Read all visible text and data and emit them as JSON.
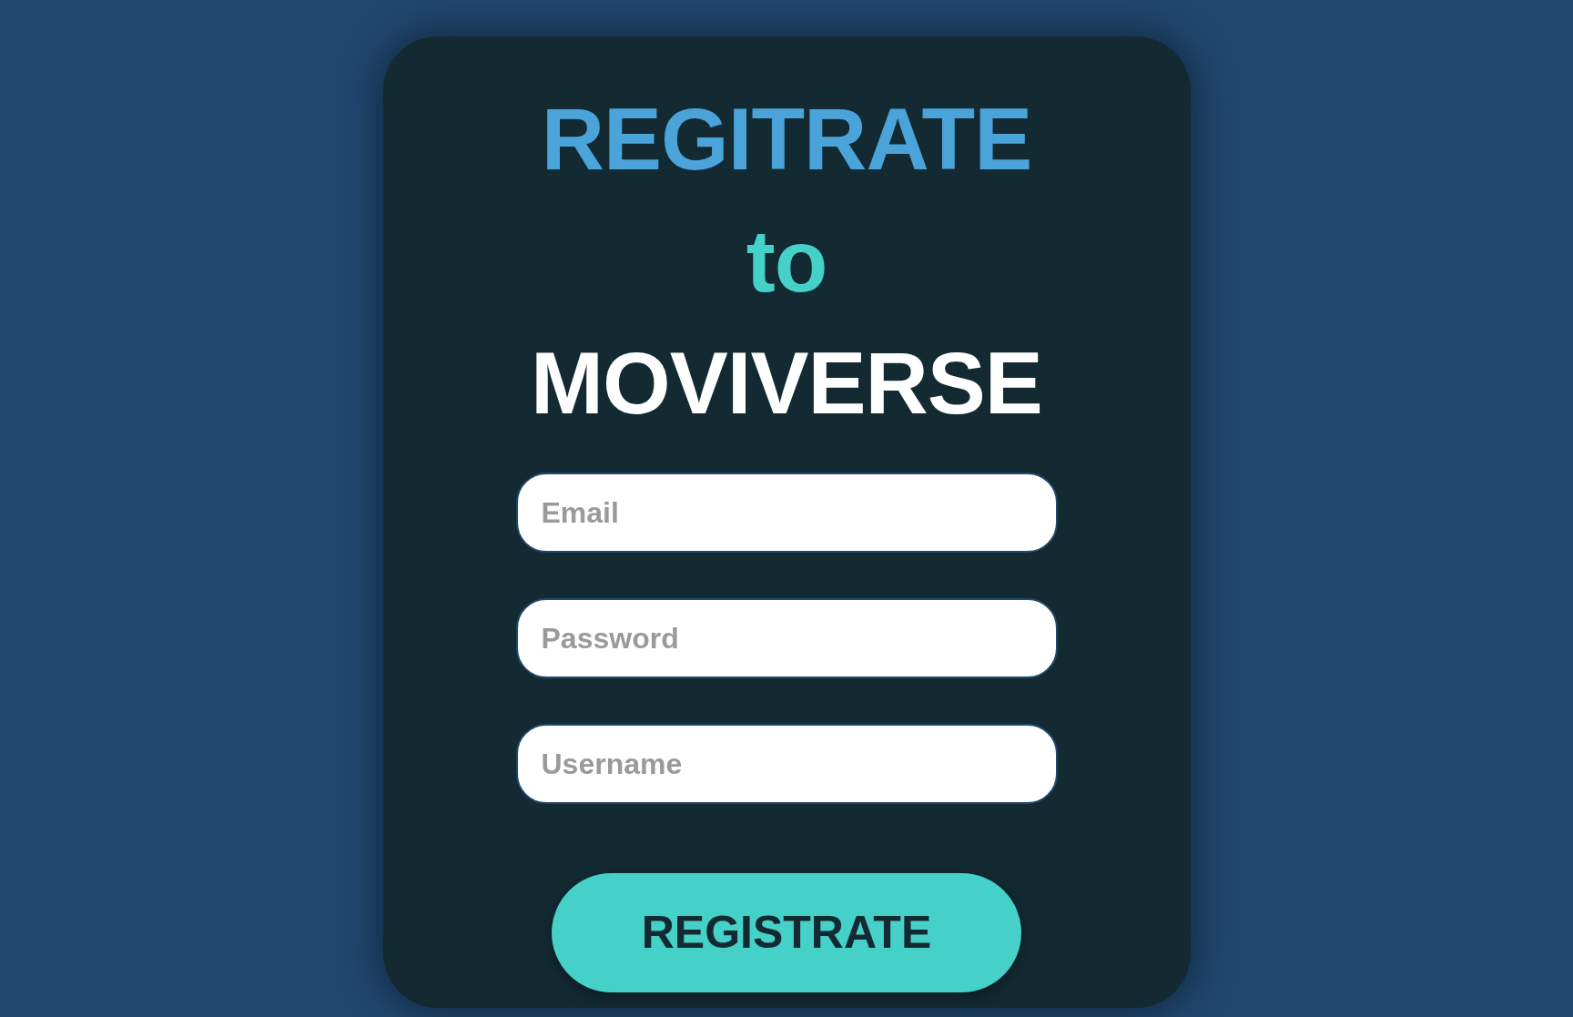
{
  "heading": [
    {
      "text": "REGITRATE",
      "color": "#4aa3d9"
    },
    {
      "text": "to",
      "color": "#45d0c8"
    },
    {
      "text": "MOVIVERSE",
      "color": "#ffffff"
    }
  ],
  "fields": [
    {
      "placeholder": "Email"
    },
    {
      "placeholder": "Password"
    },
    {
      "placeholder": "Username"
    }
  ],
  "button": {
    "label": "REGISTRATE"
  }
}
